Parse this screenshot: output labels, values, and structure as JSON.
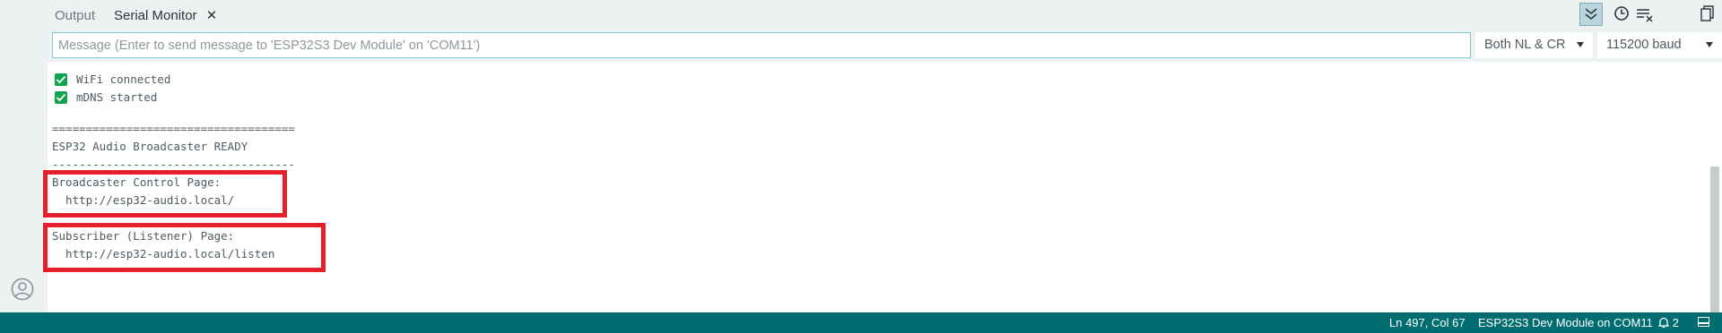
{
  "tabs": [
    {
      "label": "Output"
    },
    {
      "label": "Serial Monitor",
      "close_glyph": "✕"
    }
  ],
  "message_input": {
    "placeholder": "Message (Enter to send message to 'ESP32S3 Dev Module' on 'COM11')",
    "value": ""
  },
  "line_ending": {
    "selected": "Both NL & CR"
  },
  "baud_rate": {
    "selected": "115200 baud"
  },
  "serial_lines": [
    {
      "type": "check",
      "text": "WiFi connected"
    },
    {
      "type": "check",
      "text": "mDNS started"
    },
    {
      "type": "text",
      "text": "===================================="
    },
    {
      "type": "text",
      "text": "ESP32 Audio Broadcaster READY"
    },
    {
      "type": "text",
      "text": "------------------------------------"
    },
    {
      "type": "text",
      "text": "Broadcaster Control Page:"
    },
    {
      "type": "text",
      "text": "  http://esp32-audio.local/"
    },
    {
      "type": "text",
      "text": "Subscriber (Listener) Page:"
    },
    {
      "type": "text",
      "text": "  http://esp32-audio.local/listen"
    },
    {
      "type": "text",
      "text": "===================================="
    }
  ],
  "statusbar": {
    "cursor_position": "Ln 497, Col 67",
    "board": "ESP32S3 Dev Module on COM11",
    "notifications": "2"
  },
  "icons": {
    "autoscroll": "double-chevron-down-icon",
    "timestamp": "clock-icon",
    "clear": "clear-output-icon",
    "copy": "copy-icon",
    "account": "account-icon",
    "check": "check-icon",
    "notifications": "bell-icon",
    "panel": "toggle-panel-icon"
  },
  "colors": {
    "panel_bg": "#ecf1f1",
    "accent_teal": "#006d70",
    "check_green": "#11a44e",
    "highlight_red": "#e5202b"
  }
}
